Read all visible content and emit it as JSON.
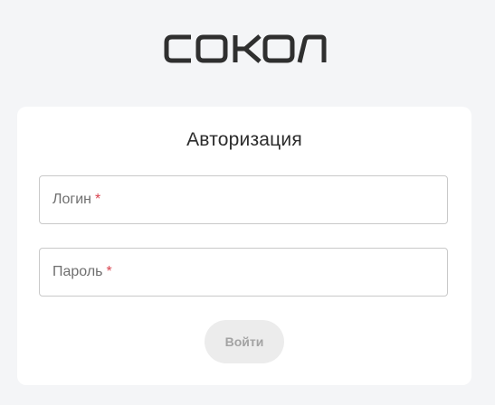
{
  "logo": {
    "text": "СОКОЛ"
  },
  "auth": {
    "title": "Авторизация",
    "login_label": "Логин",
    "password_label": "Пароль",
    "required_mark": "*",
    "submit_label": "Войти"
  },
  "colors": {
    "background": "#f4f5f7",
    "card": "#ffffff",
    "required": "#d9434f",
    "button_bg": "#ececec",
    "button_text": "#a3a3a3"
  }
}
